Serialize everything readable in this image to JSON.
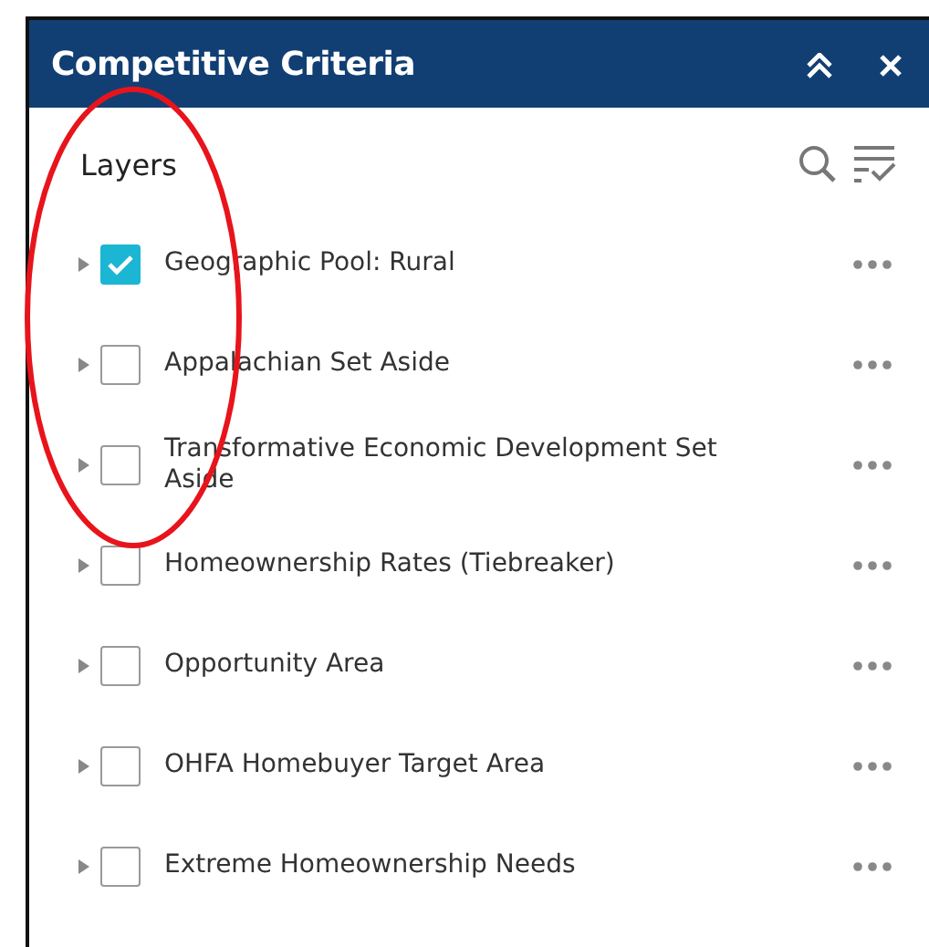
{
  "panel": {
    "title": "Competitive Criteria",
    "heading": "Layers"
  },
  "layers": [
    {
      "label": "Geographic Pool: Rural",
      "checked": true
    },
    {
      "label": "Appalachian Set Aside",
      "checked": false
    },
    {
      "label": "Transformative Economic Development Set Aside",
      "checked": false
    },
    {
      "label": "Homeownership Rates (Tiebreaker)",
      "checked": false
    },
    {
      "label": "Opportunity Area",
      "checked": false
    },
    {
      "label": "OHFA Homebuyer Target Area",
      "checked": false
    },
    {
      "label": "Extreme Homeownership Needs",
      "checked": false
    }
  ]
}
